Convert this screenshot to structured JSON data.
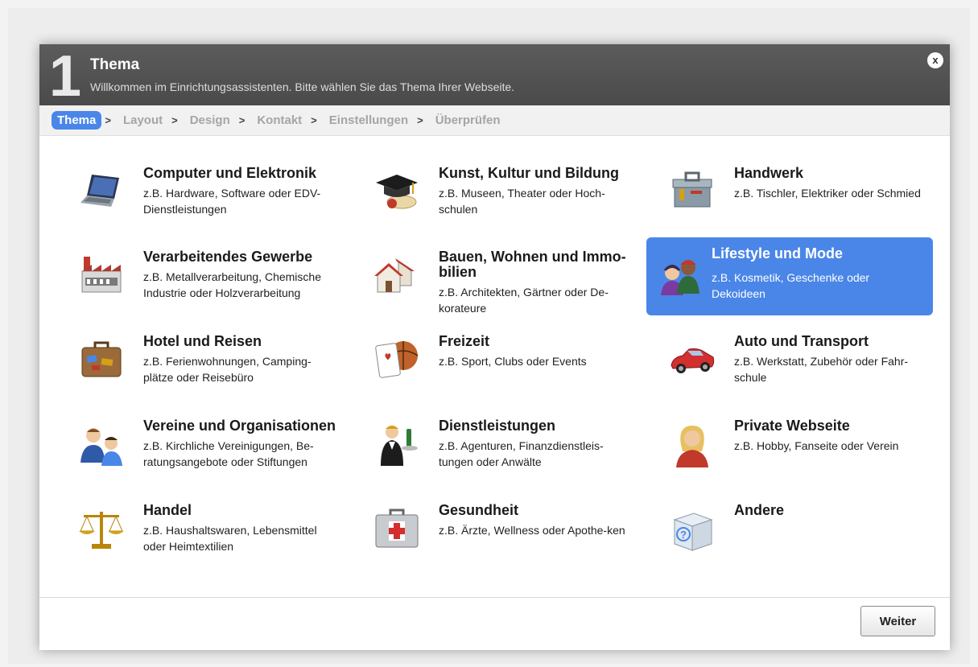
{
  "header": {
    "step_number": "1",
    "title": "Thema",
    "subtitle": "Willkommen im Einrichtungsassistenten. Bitte wählen Sie das Thema Ihrer Webseite.",
    "close_label": "x"
  },
  "breadcrumb": {
    "steps": [
      "Thema",
      "Layout",
      "Design",
      "Kontakt",
      "Einstellungen",
      "Überprüfen"
    ],
    "separator": ">",
    "active_index": 0
  },
  "categories": [
    {
      "title": "Computer und Elektronik",
      "desc": "z.B. Hardware, Software oder EDV-Dienstleistungen",
      "icon": "laptop-icon"
    },
    {
      "title": "Kunst, Kultur und Bildung",
      "desc": "z.B. Museen, Theater oder Hoch-schulen",
      "icon": "graduation-cap-icon"
    },
    {
      "title": "Handwerk",
      "desc": "z.B. Tischler, Elektriker oder Schmied",
      "icon": "toolbox-icon"
    },
    {
      "title": "Verarbeitendes Gewerbe",
      "desc": "z.B. Metallverarbeitung, Chemische Industrie oder Holzverarbeitung",
      "icon": "factory-icon"
    },
    {
      "title": "Bauen, Wohnen und Immo-bilien",
      "desc": "z.B. Architekten, Gärtner oder De-korateure",
      "icon": "houses-icon"
    },
    {
      "title": "Lifestyle und Mode",
      "desc": "z.B. Kosmetik, Geschenke oder Dekoideen",
      "icon": "people-icon"
    },
    {
      "title": "Hotel und Reisen",
      "desc": "z.B. Ferienwohnungen, Camping-plätze oder Reisebüro",
      "icon": "suitcase-icon"
    },
    {
      "title": "Freizeit",
      "desc": "z.B. Sport, Clubs oder Events",
      "icon": "card-ball-icon"
    },
    {
      "title": "Auto und Transport",
      "desc": "z.B. Werkstatt, Zubehör oder Fahr-schule",
      "icon": "car-icon"
    },
    {
      "title": "Vereine und Organisationen",
      "desc": "z.B. Kirchliche Vereinigungen, Be-ratungsangebote oder Stiftungen",
      "icon": "group-icon"
    },
    {
      "title": "Dienstleistungen",
      "desc": "z.B. Agenturen, Finanzdienstleis-tungen oder Anwälte",
      "icon": "waiter-icon"
    },
    {
      "title": "Private Webseite",
      "desc": "z.B. Hobby, Fanseite oder Verein",
      "icon": "woman-icon"
    },
    {
      "title": "Handel",
      "desc": "z.B. Haushaltswaren, Lebensmittel oder Heimtextilien",
      "icon": "scales-icon"
    },
    {
      "title": "Gesundheit",
      "desc": "z.B. Ärzte, Wellness oder Apothe-ken",
      "icon": "first-aid-icon"
    },
    {
      "title": "Andere",
      "desc": "",
      "icon": "question-box-icon"
    }
  ],
  "selected_index": 5,
  "colors": {
    "accent": "#4a86e8",
    "header_bg": "#555555"
  },
  "footer": {
    "next_label": "Weiter"
  }
}
